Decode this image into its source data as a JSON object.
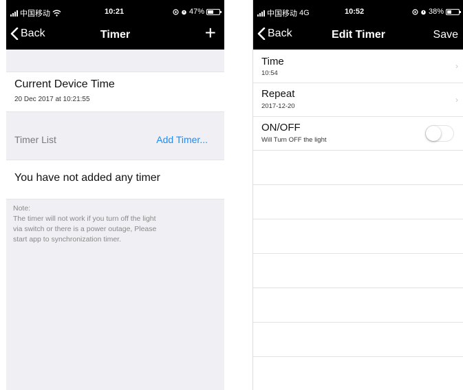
{
  "left": {
    "status": {
      "carrier": "中国移动",
      "time": "10:21",
      "battery": "47%",
      "battery_level": 0.47
    },
    "nav": {
      "back": "Back",
      "title": "Timer",
      "add": "+"
    },
    "device_time": {
      "title": "Current Device Time",
      "value": "20 Dec 2017 at 10:21:55"
    },
    "timer_list": {
      "label": "Timer List",
      "add_link": "Add Timer..."
    },
    "empty_message": "You have not added any timer",
    "note": {
      "lines": [
        "Note:",
        "The timer will not work if you turn off the light",
        "via switch or there is a power outage, Please",
        "start app to synchronization timer."
      ]
    }
  },
  "right": {
    "status": {
      "carrier": "中国移动",
      "network": "4G",
      "time": "10:52",
      "battery": "38%",
      "battery_level": 0.38
    },
    "nav": {
      "back": "Back",
      "title": "Edit Timer",
      "save": "Save"
    },
    "rows": [
      {
        "title": "Time",
        "subtitle": "10:54"
      },
      {
        "title": "Repeat",
        "subtitle": "2017-12-20"
      },
      {
        "title": "ON/OFF",
        "subtitle": "Will Turn OFF the light",
        "toggle_on": false
      }
    ]
  }
}
